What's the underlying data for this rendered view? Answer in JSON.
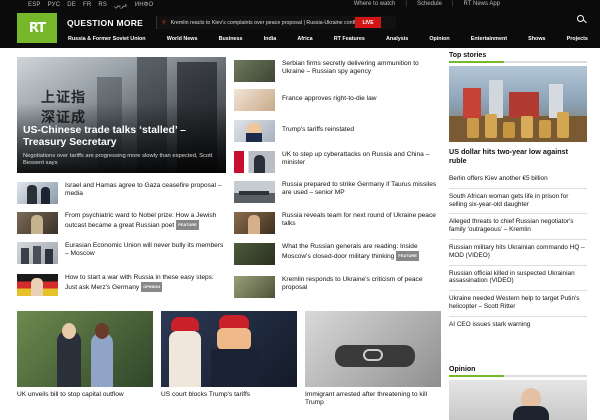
{
  "header": {
    "languages": [
      "ESP",
      "РУС",
      "DE",
      "FR",
      "RS",
      "عربي",
      "ИНФО"
    ],
    "top_links": [
      "Where to watch",
      "Schedule",
      "RT News App"
    ],
    "logo": "RT",
    "tagline": "QUESTION MORE",
    "ticker": "Kremlin reacts to Kiev's complaints over peace proposal | Russia-Ukraine conflict",
    "live_label": "LIVE",
    "nav": [
      "Russia & Former Soviet Union",
      "World News",
      "Business",
      "India",
      "Africa",
      "RT Features",
      "Analysis",
      "Opinion",
      "Entertainment",
      "Shows",
      "Projects"
    ],
    "colors": {
      "brand": "#77b82a",
      "live": "#d11414"
    }
  },
  "hero": {
    "title": "US-Chinese trade talks ‘stalled’ – Treasury Secretary",
    "subtitle": "Negotiations over tariffs are progressing more slowly than expected, Scott Bessent says",
    "overlay_text": "上证指\n深证成"
  },
  "left_list": [
    {
      "text": "Israel and Hamas agree to Gaza ceasefire proposal – media",
      "badge": ""
    },
    {
      "text": "From psychiatric ward to Nobel prize: How a Jewish outcast became a great Russian poet",
      "badge": "FEATURE"
    },
    {
      "text": "Eurasian Economic Union will never bully its members – Moscow",
      "badge": ""
    },
    {
      "text": "How to start a war with Russia in these easy steps: Just ask Merz's Germany",
      "badge": "OPINION"
    }
  ],
  "mid_list": [
    {
      "text": "Serbian firms secretly delivering ammunition to Ukraine – Russian spy agency",
      "badge": ""
    },
    {
      "text": "France approves right-to-die law",
      "badge": ""
    },
    {
      "text": "Trump's tariffs reinstated",
      "badge": ""
    },
    {
      "text": "UK to step up cyberattacks on Russia and China – minister",
      "badge": ""
    },
    {
      "text": "Russia prepared to strike Germany if Taurus missiles are used – senior MP",
      "badge": ""
    },
    {
      "text": "Russia reveals team for next round of Ukraine peace talks",
      "badge": ""
    },
    {
      "text": "What the Russian generals are reading: Inside Moscow's closed-door military thinking",
      "badge": "FEATURE"
    },
    {
      "text": "Kremlin responds to Ukraine's criticism of peace proposal",
      "badge": ""
    }
  ],
  "cards": [
    {
      "caption": "UK unveils bill to stop capital outflow"
    },
    {
      "caption": "US court blocks Trump's tariffs"
    },
    {
      "caption": "Immigrant arrested after threatening to kill Trump"
    }
  ],
  "top_stories": {
    "heading": "Top stories",
    "lead": "US dollar hits two-year low against ruble",
    "items": [
      "Berlin offers Kiev another €5 billion",
      "South African woman gets life in prison for selling six-year-old daughter",
      "Alleged threats to chief Russian negotiator's family ‘outrageous’ – Kremlin",
      "Russian military hits Ukrainian commando HQ – MOD (VIDEO)",
      "Russian official killed in suspected Ukrainian assassination (VIDEO)",
      "Ukraine needed Western help to target Putin's helicopter – Scott Ritter",
      "AI CEO issues stark warning"
    ]
  },
  "opinion": {
    "heading": "Opinion"
  }
}
